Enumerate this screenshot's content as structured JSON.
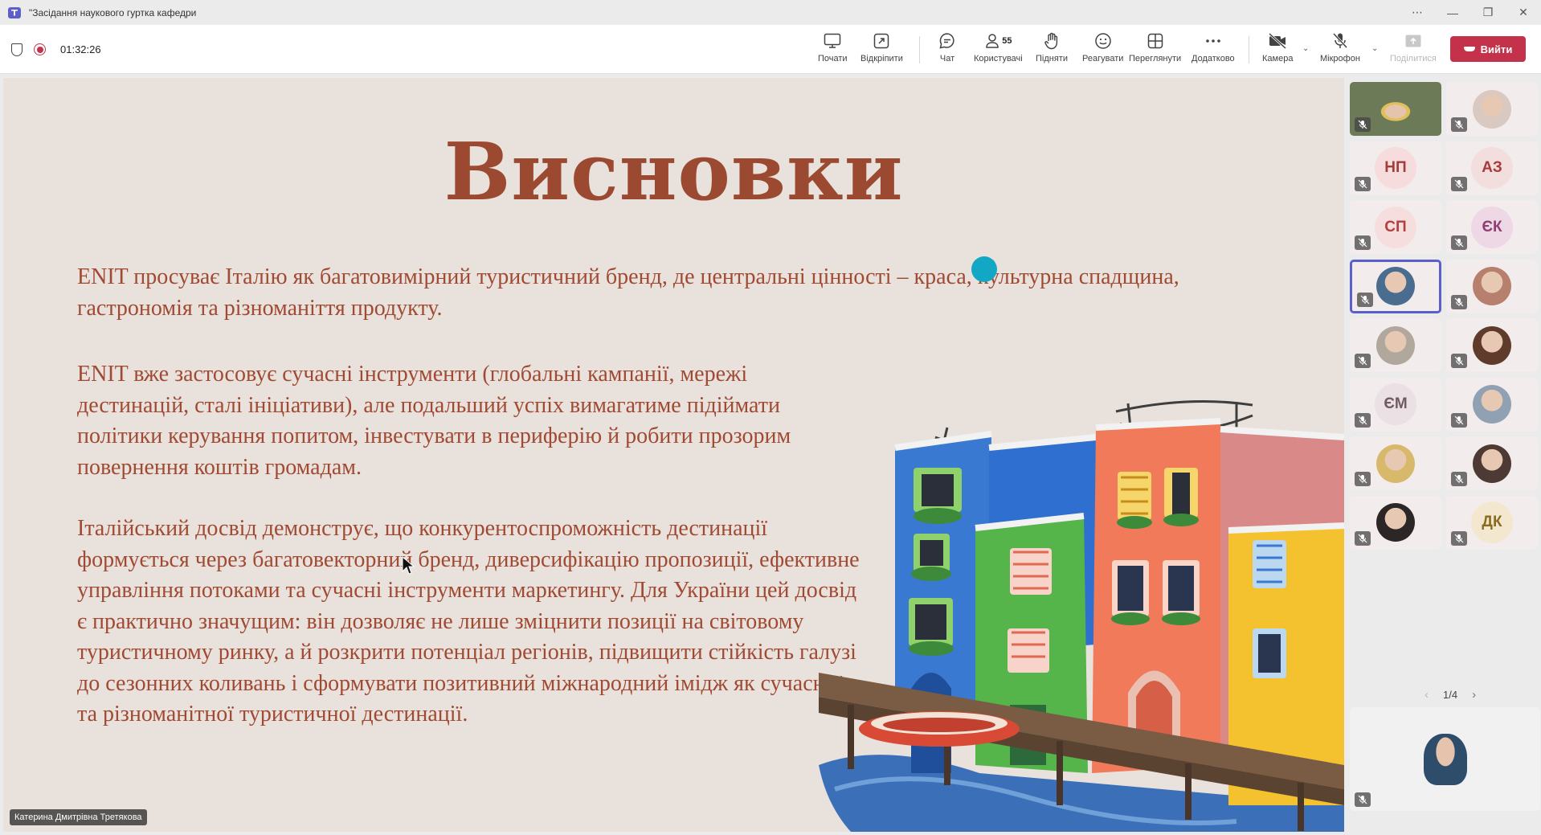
{
  "window": {
    "title": "\"Засідання наукового гуртка кафедри",
    "controls": [
      "⋯",
      "—",
      "❐",
      "✕"
    ]
  },
  "toolbar": {
    "timer": "01:32:26",
    "participants_count": "55",
    "buttons": {
      "start": "Почати",
      "popout": "Відкріпити",
      "chat": "Чат",
      "people": "Користувачі",
      "raise": "Підняти",
      "react": "Реагувати",
      "view": "Переглянути",
      "more": "Додатково",
      "camera": "Камера",
      "mic": "Мікрофон",
      "share": "Поділитися",
      "leave": "Вийти"
    },
    "colors": {
      "leave": "#c4314b",
      "accent": "#5b5fc7"
    }
  },
  "slide": {
    "title": "Висновки",
    "paragraphs": [
      "ENIT просуває Італію як багатовимірний туристичний бренд, де центральні цінності – краса, культурна спадщина, гастрономія та різноманіття продукту.",
      "ENIT вже застосовує сучасні інструменти (глобальні кампанії, мережі дестинацій, сталі ініціативи), але подальший успіх вимагатиме підіймати політики керування попитом, інвестувати в периферію й робити прозорим повернення коштів громадам.",
      "Італійський досвід демонструє, що конкурентоспроможність дестинації формується через багатовекторний бренд, диверсифікацію пропозиції, ефективне управління потоками та сучасні інструменти маркетингу. Для України цей досвід є практично значущим: він дозволяє не лише зміцнити позиції на світовому туристичному ринку, а й розкрити потенціал регіонів, підвищити стійкість галузі до сезонних коливань і сформувати позитивний міжнародний імідж як сучасної та різноманітної туристичної дестинації."
    ],
    "presenter": "Катерина Дмитрівна Третякова",
    "colors": {
      "background": "#e9e1dc",
      "text": "#a04a33",
      "title": "#9b4a31"
    }
  },
  "participants": {
    "tiles": [
      {
        "kind": "photo",
        "initials": "",
        "bg": "#6d7a58"
      },
      {
        "kind": "photo",
        "initials": "",
        "bg": "#d9c9c0"
      },
      {
        "kind": "initials",
        "initials": "НП",
        "bg": "#f6dcdc",
        "fg": "#a33d3d"
      },
      {
        "kind": "initials",
        "initials": "АЗ",
        "bg": "#f3dede",
        "fg": "#a83a3a"
      },
      {
        "kind": "initials",
        "initials": "СП",
        "bg": "#f7dede",
        "fg": "#b2403e"
      },
      {
        "kind": "initials",
        "initials": "ЄК",
        "bg": "#eed8e6",
        "fg": "#8e3e74"
      },
      {
        "kind": "photo",
        "initials": "",
        "bg": "#4a6d8f"
      },
      {
        "kind": "photo",
        "initials": "",
        "bg": "#b77f6e"
      },
      {
        "kind": "photo",
        "initials": "",
        "bg": "#b0a79d"
      },
      {
        "kind": "photo",
        "initials": "",
        "bg": "#5e3b2a"
      },
      {
        "kind": "initials",
        "initials": "ЄМ",
        "bg": "#ebe0e4",
        "fg": "#6f5b62"
      },
      {
        "kind": "photo",
        "initials": "",
        "bg": "#8fa1b2"
      },
      {
        "kind": "photo",
        "initials": "",
        "bg": "#d8b86a"
      },
      {
        "kind": "photo",
        "initials": "",
        "bg": "#4e3a34"
      },
      {
        "kind": "photo",
        "initials": "",
        "bg": "#2c2626"
      },
      {
        "kind": "initials",
        "initials": "ДК",
        "bg": "#f3e8cf",
        "fg": "#8a6b1f"
      }
    ],
    "pager": "1/4",
    "featured_bg": "#2d4d6b"
  }
}
